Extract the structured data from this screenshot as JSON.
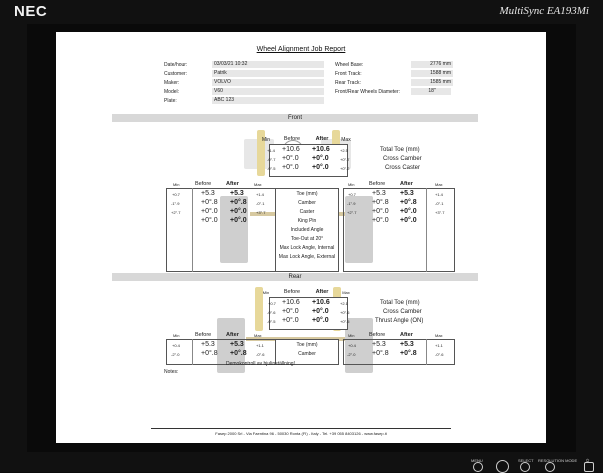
{
  "monitor": {
    "brand": "NEC",
    "model": "MultiSync EA193Mi",
    "buttons": [
      "MENU",
      "SELECT",
      "RESOLUTION MODE",
      "⏻"
    ]
  },
  "report": {
    "title": "Wheel Alignment Job Report",
    "info_left": [
      {
        "label": "Date/hour:",
        "value": "03/03/21 10:32"
      },
      {
        "label": "Customer:",
        "value": "Patrik"
      },
      {
        "label": "Maker:",
        "value": "VOLVO"
      },
      {
        "label": "Model:",
        "value": "V60"
      },
      {
        "label": "Plate:",
        "value": "ABC 123"
      }
    ],
    "info_right": [
      {
        "label": "Wheel Base:",
        "value": "2776 mm"
      },
      {
        "label": "Front Track:",
        "value": "1588 mm"
      },
      {
        "label": "Rear Track:",
        "value": "1585 mm"
      },
      {
        "label": "Front/Rear Wheels Diameter:",
        "value": "18\""
      }
    ],
    "front": {
      "section": "Front",
      "top_headers": [
        "Min",
        "Before",
        "After",
        "Max"
      ],
      "top_rows": [
        {
          "min": "+1.4",
          "before": "+10.6",
          "after": "+10.6",
          "max": "+2.5",
          "label": "Total Toe (mm)"
        },
        {
          "min": "-0°.7",
          "before": "+0°.0",
          "after": "+0°.0",
          "max": "+0°.7",
          "label": "Cross Camber"
        },
        {
          "min": "-0°.5",
          "before": "+0°.0",
          "after": "+0°.0",
          "max": "+0°.2",
          "label": "Cross Caster"
        }
      ],
      "left_headers": [
        "Min",
        "Before",
        "After",
        "Max"
      ],
      "left_rows": [
        {
          "min": "+0.7",
          "before": "+5.3",
          "after": "+5.3",
          "max": "+1.4"
        },
        {
          "min": "-1°.9",
          "before": "+0°.8",
          "after": "+0°.8",
          "max": "-0°.1"
        },
        {
          "min": "+2°.7",
          "before": "+0°.0",
          "after": "+0°.0",
          "max": "+3°.7"
        },
        {
          "min": "",
          "before": "+0°.0",
          "after": "+0°.0",
          "max": ""
        }
      ],
      "center_labels": [
        "Toe (mm)",
        "Camber",
        "Caster",
        "King Pin",
        "Included Angle",
        "Toe-Out at 20°",
        "Max Lock Angle, Internal",
        "Max Lock Angle, External"
      ],
      "right_headers": [
        "Min",
        "Before",
        "After",
        "Max"
      ],
      "right_rows": [
        {
          "min": "+0.7",
          "before": "+5.3",
          "after": "+5.3",
          "max": "+1.4"
        },
        {
          "min": "-1°.9",
          "before": "+0°.8",
          "after": "+0°.8",
          "max": "-0°.1"
        },
        {
          "min": "+2°.7",
          "before": "+0°.0",
          "after": "+0°.0",
          "max": "+3°.7"
        },
        {
          "min": "",
          "before": "+0°.0",
          "after": "+0°.0",
          "max": ""
        }
      ]
    },
    "rear": {
      "section": "Rear",
      "top_headers": [
        "Min",
        "Before",
        "After",
        "Max"
      ],
      "top_rows": [
        {
          "min": "+0.7",
          "before": "+10.6",
          "after": "+10.6",
          "max": "+2.1",
          "label": "Total Toe (mm)"
        },
        {
          "min": "-0°.6",
          "before": "+0°.0",
          "after": "+0°.0",
          "max": "+0°.6",
          "label": "Cross Camber"
        },
        {
          "min": "-0°.5",
          "before": "+0°.0",
          "after": "+0°.0",
          "max": "+0°.5",
          "label": "Thrust Angle (ON)"
        }
      ],
      "left_headers": [
        "Min",
        "Before",
        "After",
        "Max"
      ],
      "left_rows": [
        {
          "min": "+0.4",
          "before": "+5.3",
          "after": "+5.3",
          "max": "+1.1"
        },
        {
          "min": "-2°.0",
          "before": "+0°.8",
          "after": "+0°.8",
          "max": "-0°.6"
        }
      ],
      "center_labels": [
        "Toe (mm)",
        "Camber"
      ],
      "right_headers": [
        "Min",
        "Before",
        "After",
        "Max"
      ],
      "right_rows": [
        {
          "min": "+0.4",
          "before": "+5.3",
          "after": "+5.3",
          "max": "+1.1"
        },
        {
          "min": "-2°.0",
          "before": "+0°.8",
          "after": "+0°.8",
          "max": "-0°.6"
        }
      ]
    },
    "notes_label": "Notes:",
    "notes_text": "Demokontroll av hjulinställning!",
    "footer": "Fasep 2000 Srl - Via Faentina 96 - 50030 Ronta (FI) - Italy - Tel. +39 055 8403126 - www.fasep.it"
  }
}
